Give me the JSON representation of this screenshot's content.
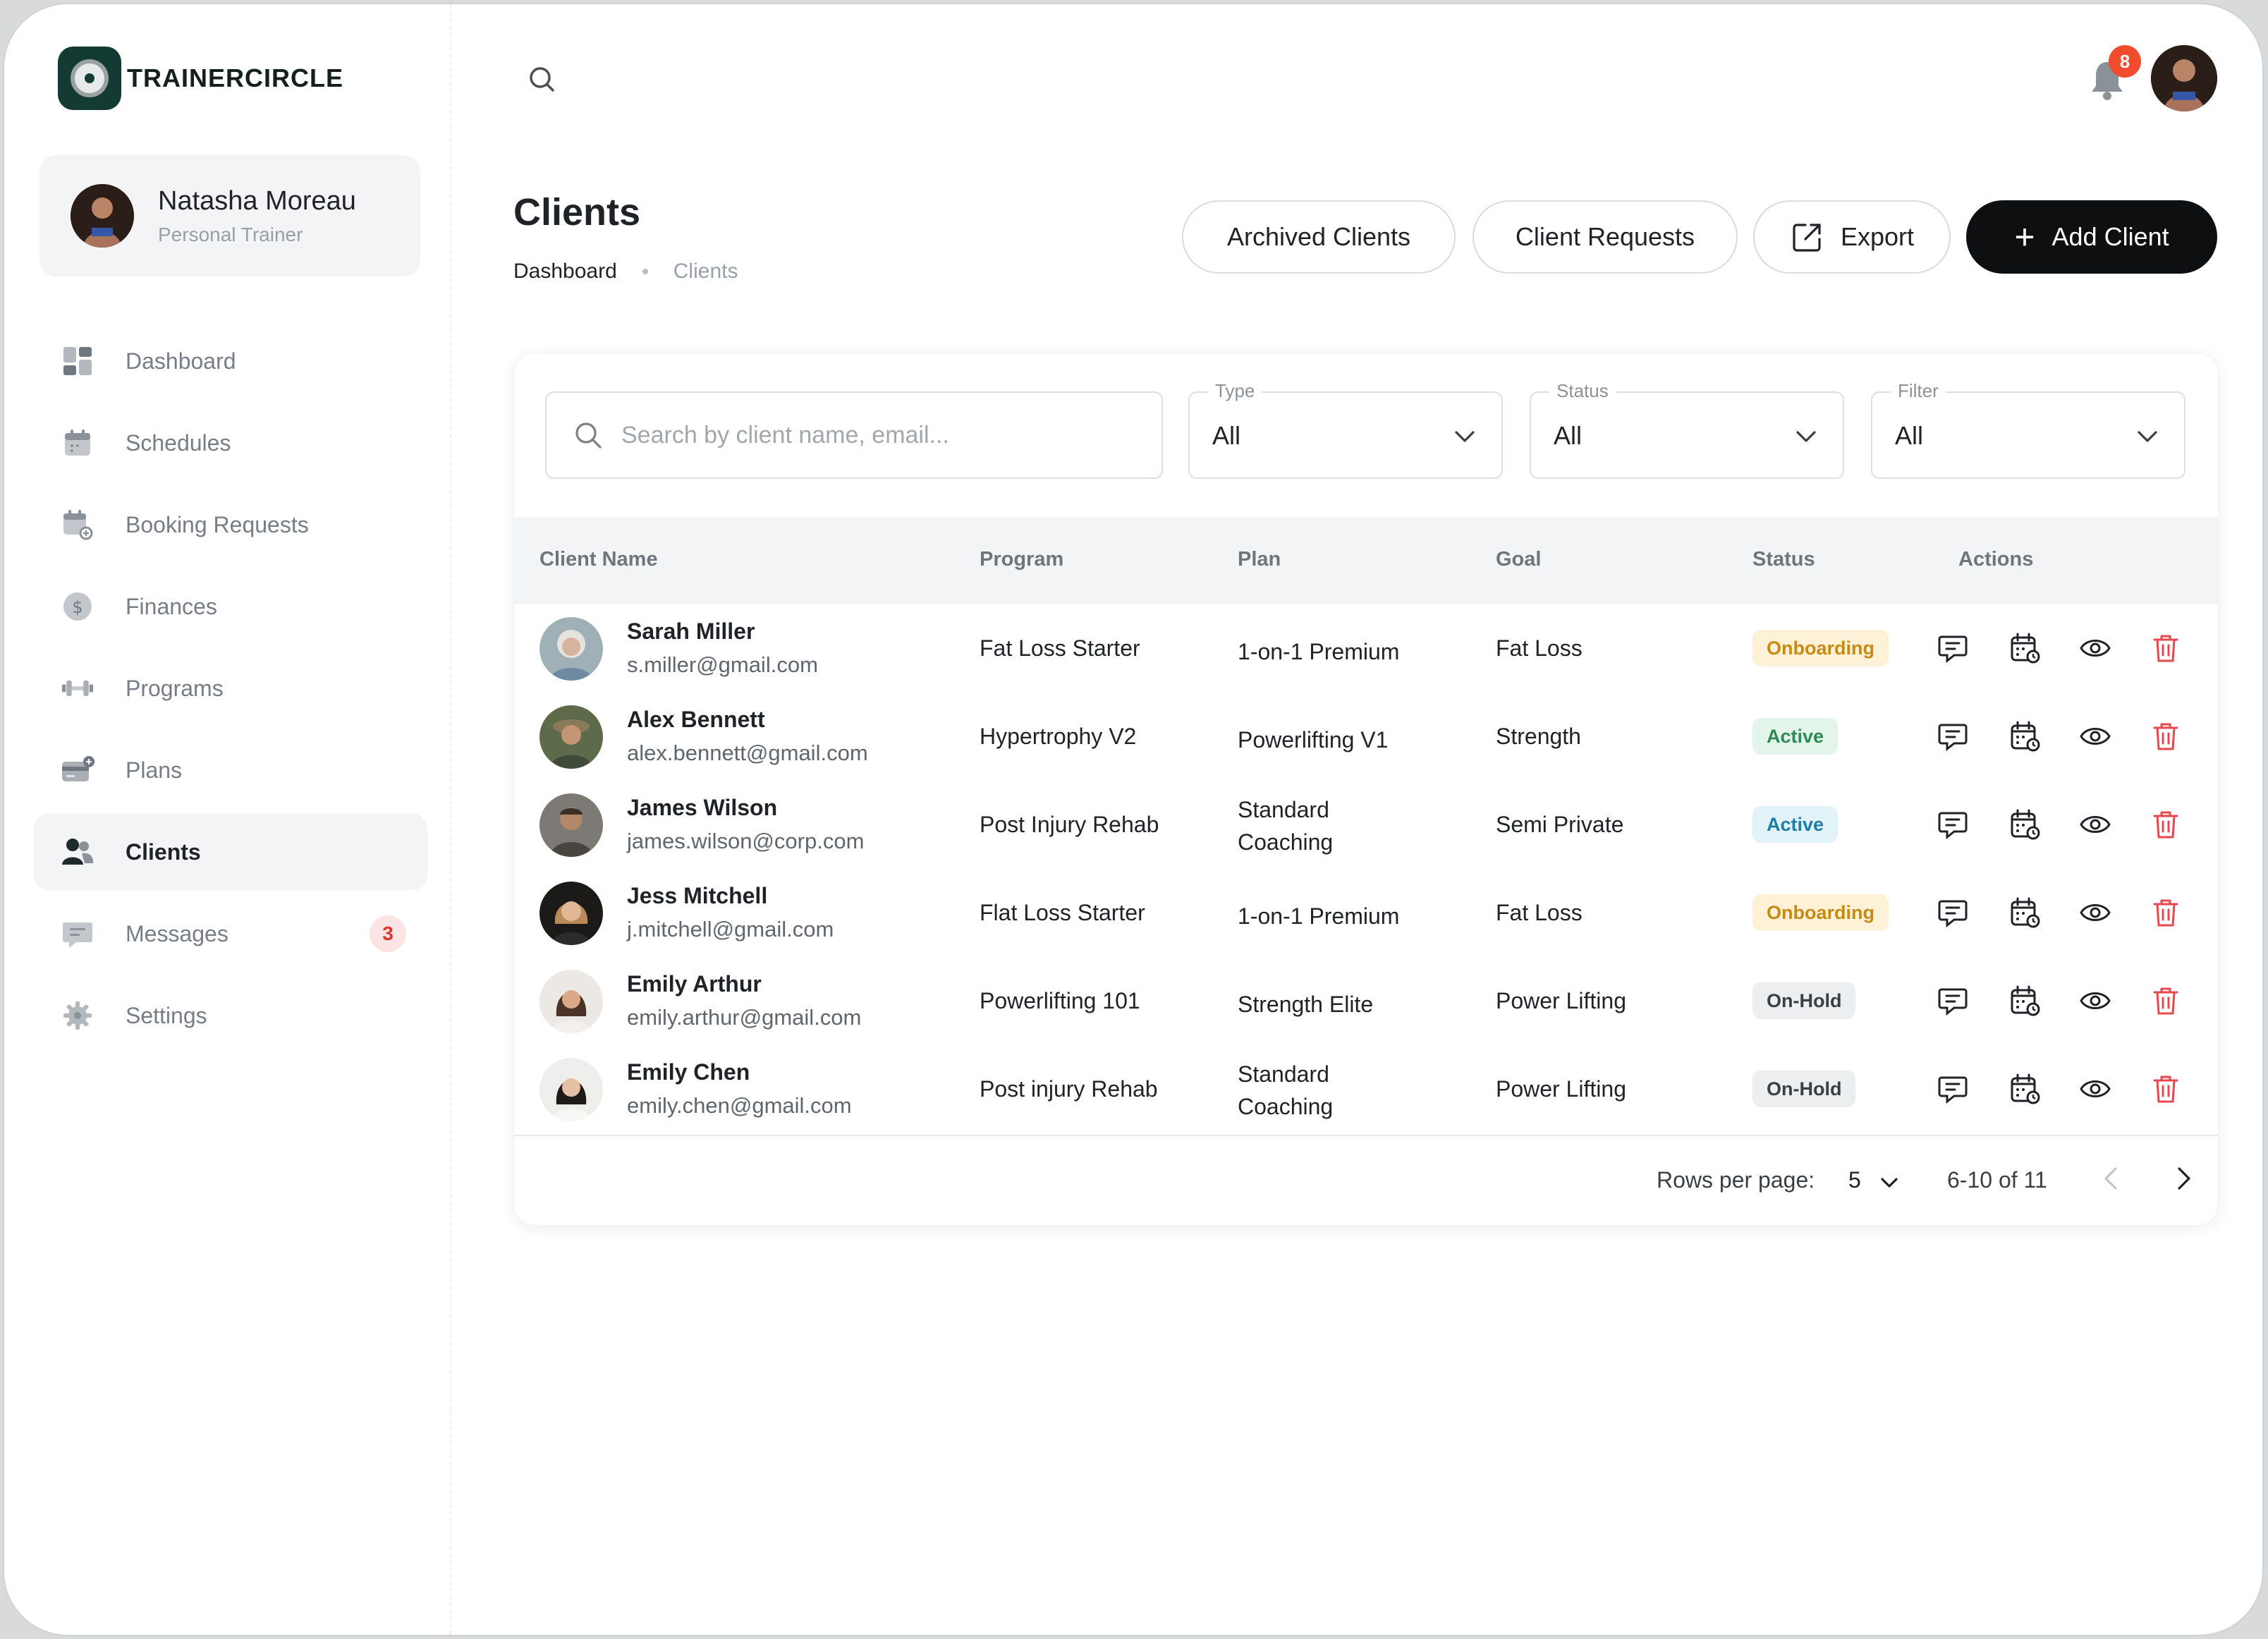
{
  "brand": {
    "name": "TRAINERCIRCLE"
  },
  "profile": {
    "name": "Natasha Moreau",
    "role": "Personal Trainer"
  },
  "sidebar": {
    "items": [
      {
        "label": "Dashboard",
        "icon": "dashboard-icon"
      },
      {
        "label": "Schedules",
        "icon": "calendar-icon"
      },
      {
        "label": "Booking Requests",
        "icon": "calendar-add-icon"
      },
      {
        "label": "Finances",
        "icon": "dollar-icon"
      },
      {
        "label": "Programs",
        "icon": "dumbbell-icon"
      },
      {
        "label": "Plans",
        "icon": "card-icon"
      },
      {
        "label": "Clients",
        "icon": "users-icon",
        "active": true
      },
      {
        "label": "Messages",
        "icon": "message-icon",
        "badge": "3"
      },
      {
        "label": "Settings",
        "icon": "gear-icon"
      }
    ]
  },
  "topbar": {
    "notification_count": "8"
  },
  "header": {
    "title": "Clients",
    "breadcrumb": [
      "Dashboard",
      "Clients"
    ],
    "buttons": {
      "archived": "Archived Clients",
      "requests": "Client Requests",
      "export": "Export",
      "add": "Add Client"
    }
  },
  "filters": {
    "search_placeholder": "Search by client name, email...",
    "type": {
      "label": "Type",
      "value": "All"
    },
    "status": {
      "label": "Status",
      "value": "All"
    },
    "filter": {
      "label": "Filter",
      "value": "All"
    }
  },
  "table": {
    "columns": [
      "Client Name",
      "Program",
      "Plan",
      "Goal",
      "Status",
      "Actions"
    ],
    "rows": [
      {
        "name": "Sarah Miller",
        "email": "s.miller@gmail.com",
        "program": "Fat Loss Starter",
        "plan": "1-on-1 Premium",
        "goal": "Fat Loss",
        "status": "Onboarding"
      },
      {
        "name": "Alex Bennett",
        "email": "alex.bennett@gmail.com",
        "program": "Hypertrophy V2",
        "plan": "Powerlifting V1",
        "goal": "Strength",
        "status": "Active"
      },
      {
        "name": "James Wilson",
        "email": "james.wilson@corp.com",
        "program": "Post Injury Rehab",
        "plan": "Standard Coaching",
        "goal": "Semi Private",
        "status": "Active"
      },
      {
        "name": "Jess Mitchell",
        "email": "j.mitchell@gmail.com",
        "program": "Flat Loss Starter",
        "plan": "1-on-1 Premium",
        "goal": "Fat Loss",
        "status": "Onboarding"
      },
      {
        "name": "Emily Arthur",
        "email": "emily.arthur@gmail.com",
        "program": "Powerlifting 101",
        "plan": "Strength Elite",
        "goal": "Power Lifting",
        "status": "On-Hold"
      },
      {
        "name": "Emily Chen",
        "email": "emily.chen@gmail.com",
        "program": "Post injury Rehab",
        "plan": "Standard Coaching",
        "goal": "Power Lifting",
        "status": "On-Hold"
      }
    ]
  },
  "pagination": {
    "rows_per_page_label": "Rows per page:",
    "rows_per_page": "5",
    "range": "6-10 of 11"
  },
  "colors": {
    "brand": "#133b34",
    "primary_button": "#0d0f10",
    "onboarding": "#c98a12",
    "active_green": "#2c8a55",
    "active_blue": "#1d7da8",
    "delete": "#e5484d"
  }
}
